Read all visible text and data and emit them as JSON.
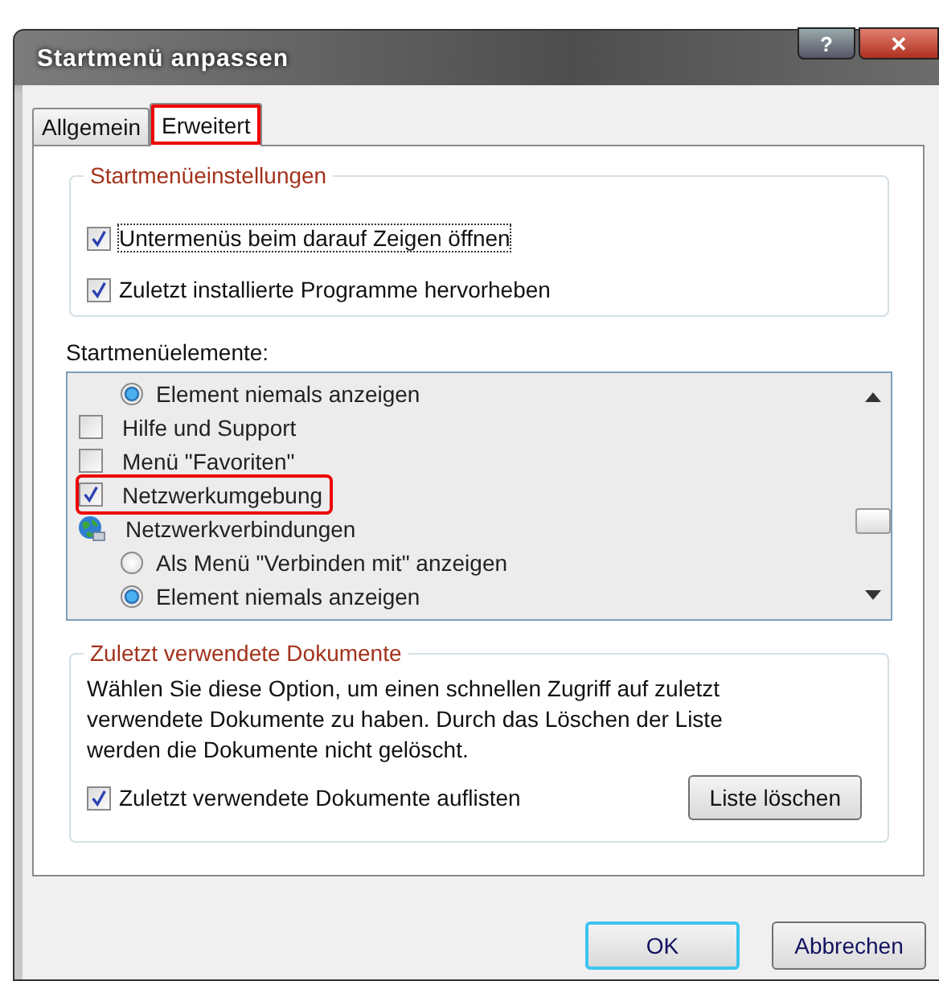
{
  "window": {
    "title": "Startmenü anpassen",
    "help_button": "?",
    "close_button": "✕"
  },
  "tabs": [
    {
      "label": "Allgemein",
      "selected": false,
      "highlighted": false
    },
    {
      "label": "Erweitert",
      "selected": true,
      "highlighted": true
    }
  ],
  "settings_group": {
    "title": "Startmenüeinstellungen",
    "options": [
      {
        "label": "Untermenüs beim darauf Zeigen öffnen",
        "checked": true,
        "focused": true
      },
      {
        "label": "Zuletzt installierte Programme hervorheben",
        "checked": true,
        "focused": false
      }
    ]
  },
  "items_label": "Startmenüelemente:",
  "items": [
    {
      "kind": "radio",
      "label": "Element niemals anzeigen",
      "selected": true,
      "highlighted": false
    },
    {
      "kind": "checkbox",
      "label": "Hilfe und Support",
      "checked": false,
      "highlighted": false
    },
    {
      "kind": "checkbox",
      "label": "Menü \"Favoriten\"",
      "checked": false,
      "highlighted": false
    },
    {
      "kind": "checkbox",
      "label": "Netzwerkumgebung",
      "checked": true,
      "highlighted": true
    },
    {
      "kind": "heading",
      "label": "Netzwerkverbindungen",
      "highlighted": false
    },
    {
      "kind": "radio",
      "label": "Als Menü \"Verbinden mit\" anzeigen",
      "selected": false,
      "highlighted": false
    },
    {
      "kind": "radio",
      "label": "Element niemals anzeigen",
      "selected": true,
      "highlighted": false
    }
  ],
  "documents_group": {
    "title": "Zuletzt verwendete Dokumente",
    "description": "Wählen Sie diese Option, um einen schnellen Zugriff auf zuletzt verwendete Dokumente zu haben. Durch das Löschen der Liste werden die Dokumente nicht gelöscht.",
    "option": {
      "label": "Zuletzt verwendete Dokumente auflisten",
      "checked": true
    },
    "clear_button": "Liste löschen"
  },
  "buttons": [
    {
      "label": "OK",
      "default": true
    },
    {
      "label": "Abbrechen",
      "default": false
    }
  ]
}
